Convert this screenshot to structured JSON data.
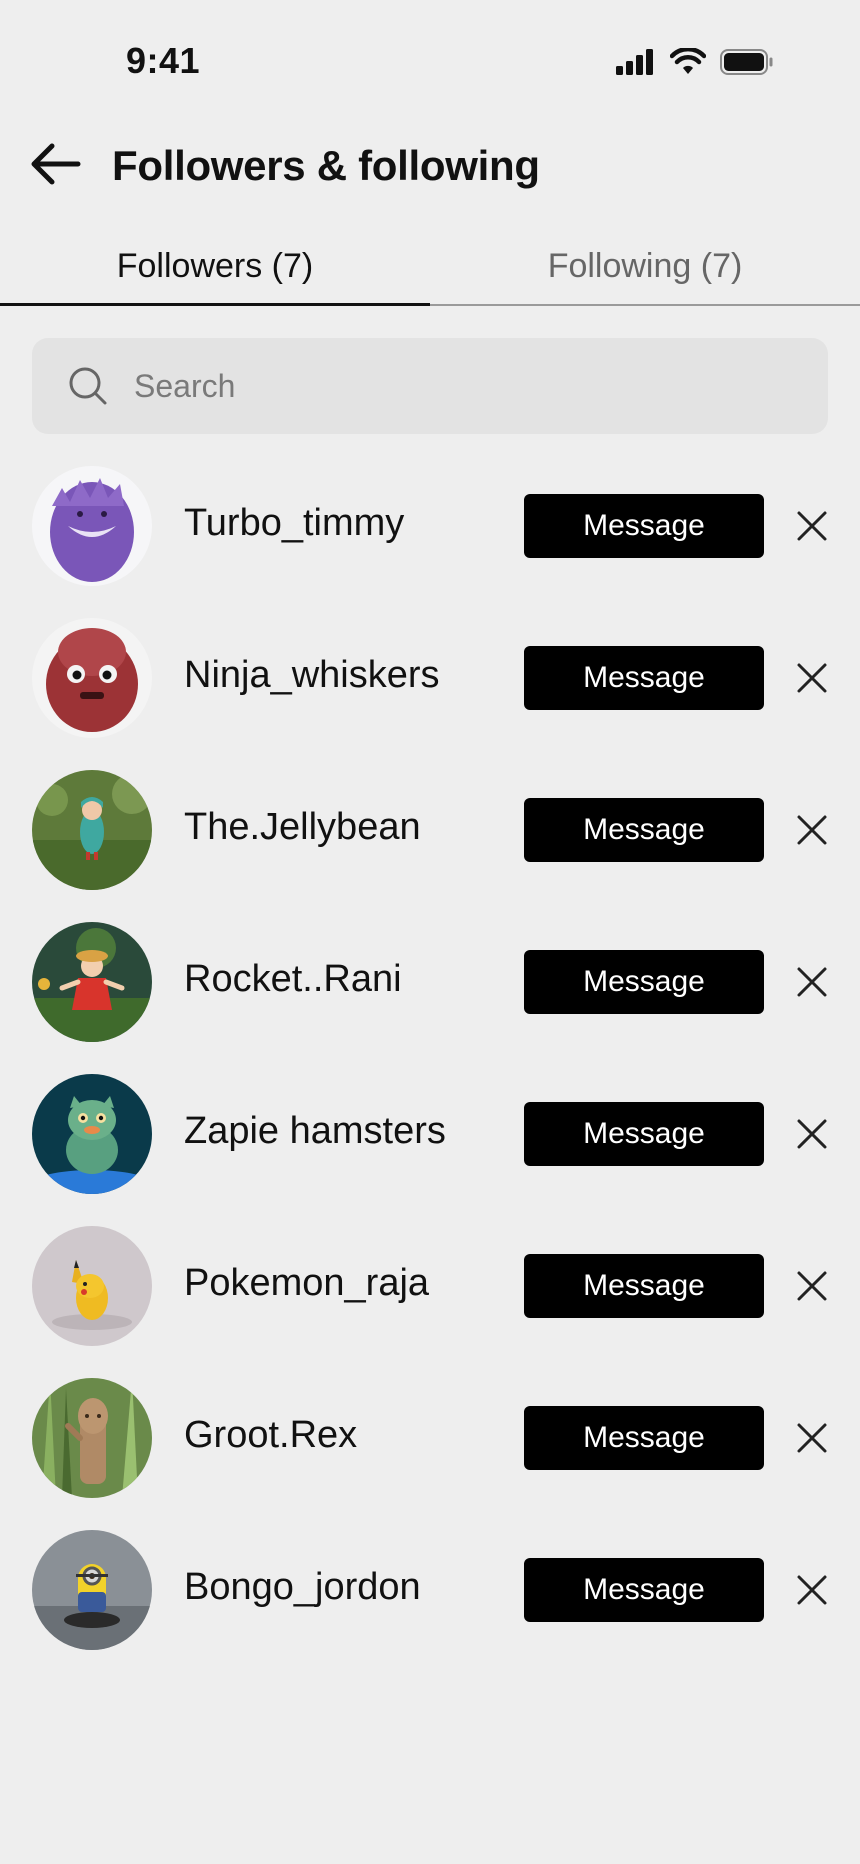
{
  "status_bar": {
    "time": "9:41"
  },
  "header": {
    "title": "Followers & following"
  },
  "tabs": [
    {
      "label": "Followers (7)",
      "active": true
    },
    {
      "label": "Following (7)",
      "active": false
    }
  ],
  "search": {
    "placeholder": "Search",
    "value": ""
  },
  "followers": [
    {
      "username": "Turbo_timmy",
      "action_label": "Message",
      "avatar": "purple-fuzzy-monster"
    },
    {
      "username": "Ninja_whiskers",
      "action_label": "Message",
      "avatar": "red-fuzzy-monster"
    },
    {
      "username": "The.Jellybean",
      "action_label": "Message",
      "avatar": "toy-in-green-raincoat"
    },
    {
      "username": "Rocket..Rani",
      "action_label": "Message",
      "avatar": "toy-in-red-dress"
    },
    {
      "username": "Zapie hamsters",
      "action_label": "Message",
      "avatar": "green-cat-toy"
    },
    {
      "username": "Pokemon_raja",
      "action_label": "Message",
      "avatar": "yellow-pikachu-toy"
    },
    {
      "username": "Groot.Rex",
      "action_label": "Message",
      "avatar": "wooden-groot-toy"
    },
    {
      "username": "Bongo_jordon",
      "action_label": "Message",
      "avatar": "minion-toy"
    }
  ],
  "colors": {
    "background": "#eeeeee",
    "button": "#000000",
    "button_text": "#ffffff",
    "search_bg": "#e3e3e3"
  }
}
